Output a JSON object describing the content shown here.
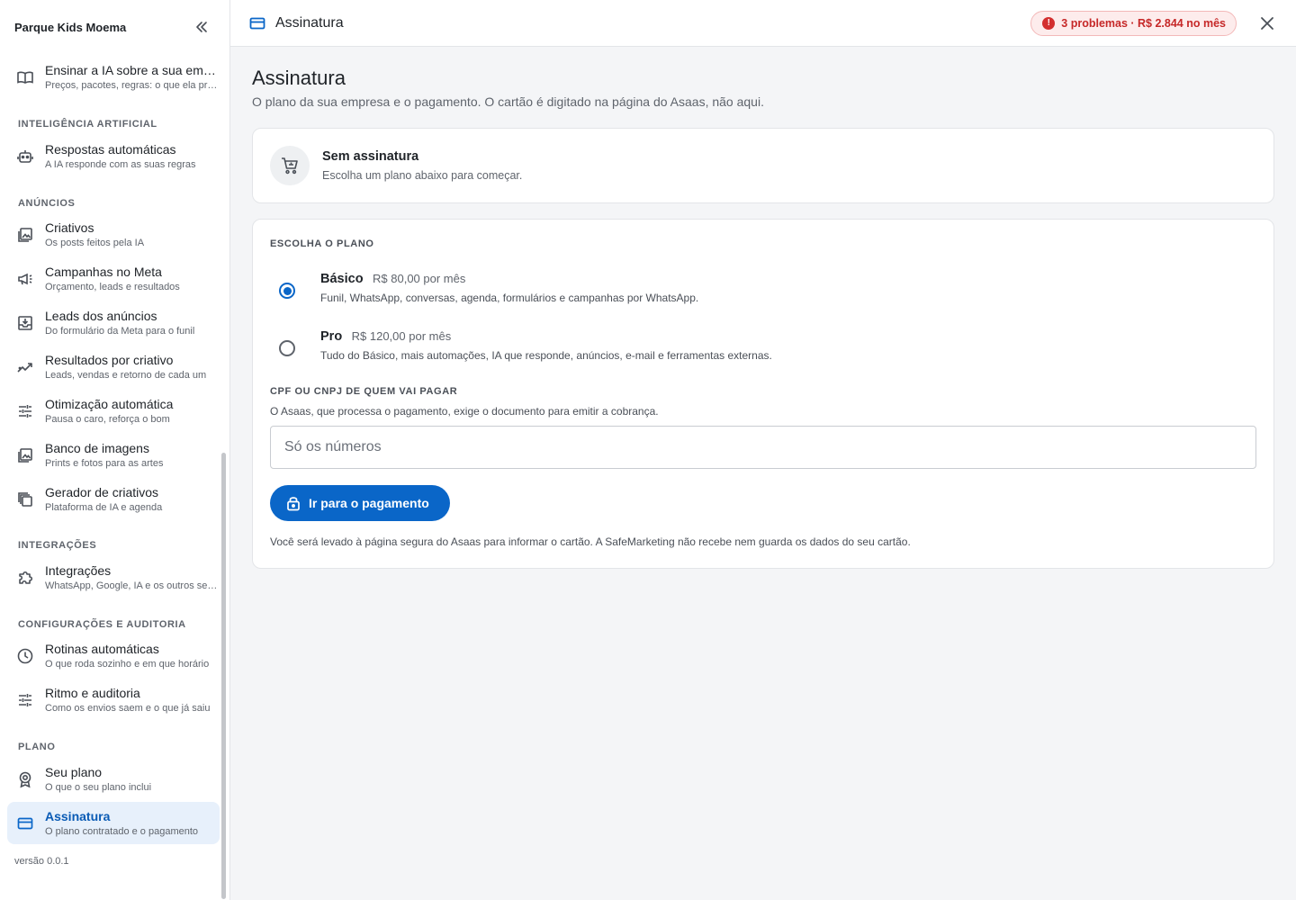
{
  "sidebar": {
    "company": "Parque Kids Moema",
    "top_items": [
      {
        "label": "Ensinar a IA sobre a sua empresa",
        "sub": "Preços, pacotes, regras: o que ela precisa saber",
        "icon": "book-open-icon"
      }
    ],
    "sections": [
      {
        "title": "INTELIGÊNCIA ARTIFICIAL",
        "items": [
          {
            "label": "Respostas automáticas",
            "sub": "A IA responde com as suas regras",
            "icon": "robot-icon"
          }
        ]
      },
      {
        "title": "ANÚNCIOS",
        "items": [
          {
            "label": "Criativos",
            "sub": "Os posts feitos pela IA",
            "icon": "image-gallery-icon"
          },
          {
            "label": "Campanhas no Meta",
            "sub": "Orçamento, leads e resultados",
            "icon": "megaphone-icon"
          },
          {
            "label": "Leads dos anúncios",
            "sub": "Do formulário da Meta para o funil",
            "icon": "inbox-download-icon"
          },
          {
            "label": "Resultados por criativo",
            "sub": "Leads, vendas e retorno de cada um",
            "icon": "trending-up-icon"
          },
          {
            "label": "Otimização automática",
            "sub": "Pausa o caro, reforça o bom",
            "icon": "tune-icon"
          },
          {
            "label": "Banco de imagens",
            "sub": "Prints e fotos para as artes",
            "icon": "photo-library-icon"
          },
          {
            "label": "Gerador de criativos",
            "sub": "Plataforma de IA e agenda",
            "icon": "copy-layers-icon"
          }
        ]
      },
      {
        "title": "INTEGRAÇÕES",
        "items": [
          {
            "label": "Integrações",
            "sub": "WhatsApp, Google, IA e os outros serviços",
            "icon": "puzzle-icon"
          }
        ]
      },
      {
        "title": "CONFIGURAÇÕES E AUDITORIA",
        "items": [
          {
            "label": "Rotinas automáticas",
            "sub": "O que roda sozinho e em que horário",
            "icon": "clock-icon"
          },
          {
            "label": "Ritmo e auditoria",
            "sub": "Como os envios saem e o que já saiu",
            "icon": "tune-icon"
          }
        ]
      },
      {
        "title": "PLANO",
        "items": [
          {
            "label": "Seu plano",
            "sub": "O que o seu plano inclui",
            "icon": "award-icon"
          },
          {
            "label": "Assinatura",
            "sub": "O plano contratado e o pagamento",
            "icon": "credit-card-icon",
            "active": true
          }
        ]
      }
    ],
    "version": "versão 0.0.1"
  },
  "topbar": {
    "title": "Assinatura",
    "problems_badge": "3 problemas · R$ 2.844 no mês"
  },
  "main": {
    "title": "Assinatura",
    "subtitle": "O plano da sua empresa e o pagamento. O cartão é digitado na página do Asaas, não aqui.",
    "status": {
      "title": "Sem assinatura",
      "desc": "Escolha um plano abaixo para começar."
    },
    "plans_caption": "ESCOLHA O PLANO",
    "plans": [
      {
        "name": "Básico",
        "price": "R$ 80,00 por mês",
        "desc": "Funil, WhatsApp, conversas, agenda, formulários e campanhas por WhatsApp.",
        "selected": true
      },
      {
        "name": "Pro",
        "price": "R$ 120,00 por mês",
        "desc": "Tudo do Básico, mais automações, IA que responde, anúncios, e-mail e ferramentas externas.",
        "selected": false
      }
    ],
    "doc_caption": "CPF OU CNPJ DE QUEM VAI PAGAR",
    "doc_help": "O Asaas, que processa o pagamento, exige o documento para emitir a cobrança.",
    "doc_value": "",
    "doc_placeholder": "Só os números",
    "pay_button": "Ir para o pagamento",
    "note": "Você será levado à página segura do Asaas para informar o cartão. A SafeMarketing não recebe nem guarda os dados do seu cartão."
  },
  "colors": {
    "accent": "#0a66c8",
    "active_bg": "#e7f0fb",
    "danger": "#c62828",
    "danger_bg": "#fdecec"
  }
}
